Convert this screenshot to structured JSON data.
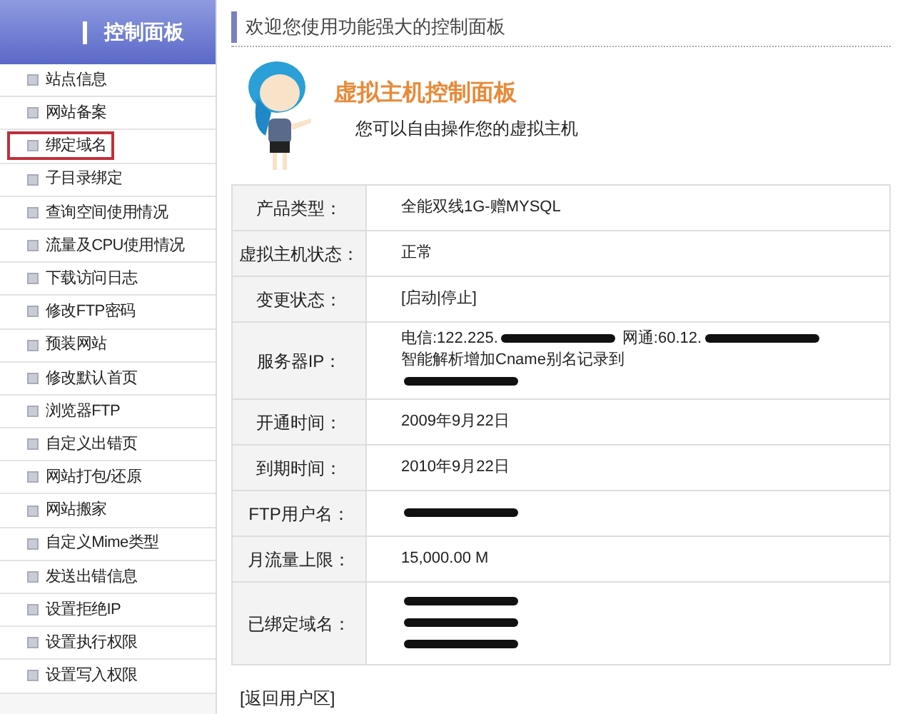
{
  "sidebar": {
    "title": "控制面板",
    "items": [
      {
        "label": "站点信息",
        "selected": false
      },
      {
        "label": "网站备案",
        "selected": false
      },
      {
        "label": "绑定域名",
        "selected": true
      },
      {
        "label": "子目录绑定",
        "selected": false
      },
      {
        "label": "查询空间使用情况",
        "selected": false
      },
      {
        "label": "流量及CPU使用情况",
        "selected": false
      },
      {
        "label": "下载访问日志",
        "selected": false
      },
      {
        "label": "修改FTP密码",
        "selected": false
      },
      {
        "label": "预装网站",
        "selected": false
      },
      {
        "label": "修改默认首页",
        "selected": false
      },
      {
        "label": "浏览器FTP",
        "selected": false
      },
      {
        "label": "自定义出错页",
        "selected": false
      },
      {
        "label": "网站打包/还原",
        "selected": false
      },
      {
        "label": "网站搬家",
        "selected": false
      },
      {
        "label": "自定义Mime类型",
        "selected": false
      },
      {
        "label": "发送出错信息",
        "selected": false
      },
      {
        "label": "设置拒绝IP",
        "selected": false
      },
      {
        "label": "设置执行权限",
        "selected": false
      },
      {
        "label": "设置写入权限",
        "selected": false
      }
    ]
  },
  "header": {
    "welcome": "欢迎您使用功能强大的控制面板"
  },
  "banner": {
    "title": "虚拟主机控制面板",
    "subtitle": "您可以自由操作您的虚拟主机"
  },
  "info_table": {
    "rows": [
      {
        "label": "产品类型：",
        "parts": [
          {
            "kind": "text",
            "text": "全能双线1G-赠MYSQL"
          }
        ]
      },
      {
        "label": "虚拟主机状态：",
        "parts": [
          {
            "kind": "text",
            "text": "正常"
          }
        ]
      },
      {
        "label": "变更状态：",
        "parts": [
          {
            "kind": "text",
            "text": "[启动|停止]"
          }
        ]
      },
      {
        "label": "服务器IP：",
        "parts": [
          {
            "kind": "text",
            "text": "电信:122.225."
          },
          {
            "kind": "redacted"
          },
          {
            "kind": "text",
            "text": " 网通:60.12."
          },
          {
            "kind": "redacted"
          },
          {
            "kind": "text",
            "text": "智能解析增加Cname别名记录到"
          },
          {
            "kind": "break"
          },
          {
            "kind": "redacted"
          }
        ]
      },
      {
        "label": "开通时间：",
        "parts": [
          {
            "kind": "text",
            "text": "2009年9月22日"
          }
        ]
      },
      {
        "label": "到期时间：",
        "parts": [
          {
            "kind": "text",
            "text": "2010年9月22日"
          }
        ]
      },
      {
        "label": "FTP用户名：",
        "parts": [
          {
            "kind": "redacted"
          }
        ]
      },
      {
        "label": "月流量上限：",
        "parts": [
          {
            "kind": "text",
            "text": "15,000.00 M"
          }
        ]
      },
      {
        "label": "已绑定域名：",
        "parts": [
          {
            "kind": "redacted"
          },
          {
            "kind": "break"
          },
          {
            "kind": "redacted"
          },
          {
            "kind": "break"
          },
          {
            "kind": "redacted"
          }
        ]
      }
    ]
  },
  "footer_link": "[返回用户区]"
}
